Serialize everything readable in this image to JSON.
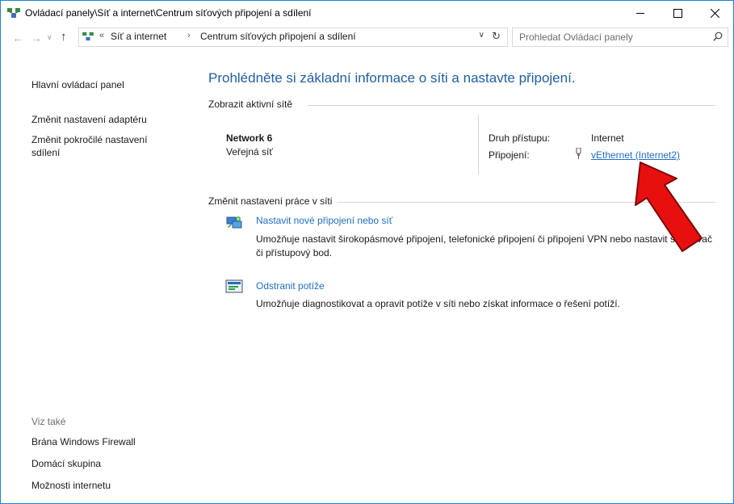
{
  "window": {
    "title": "Ovládací panely\\Síť a internet\\Centrum síťových připojení a sdílení",
    "controls": {
      "minimize": "—",
      "maximize": "☐",
      "close": "✕"
    }
  },
  "address": {
    "overflow": "«",
    "crumbs": [
      "Síť a internet",
      "Centrum síťových připojení a sdílení"
    ],
    "separator": "›",
    "search_placeholder": "Prohledat Ovládací panely"
  },
  "sidebar": {
    "main_link": "Hlavní ovládací panel",
    "links": [
      "Změnit nastavení adaptéru",
      "Změnit pokročilé nastavení sdílení"
    ],
    "see_also_title": "Viz také",
    "see_also": [
      "Brána Windows Firewall",
      "Domácí skupina",
      "Možnosti internetu"
    ]
  },
  "main": {
    "heading": "Prohlédněte si základní informace o síti a nastavte připojení.",
    "active_networks_label": "Zobrazit aktivní sítě",
    "network": {
      "name": "Network  6",
      "type": "Veřejná síť",
      "access_label": "Druh přístupu:",
      "access_value": "Internet",
      "connection_label": "Připojení:",
      "connection_value": "vEthernet (Internet2)"
    },
    "change_settings_label": "Změnit nastavení práce v síti",
    "tasks": [
      {
        "title": "Nastavit nové připojení nebo síť",
        "desc": "Umožňuje nastavit širokopásmové připojení, telefonické připojení či připojení VPN nebo nastavit směrovač či přístupový bod."
      },
      {
        "title": "Odstranit potíže",
        "desc": "Umožňuje diagnostikovat a opravit potíže v síti nebo získat informace o řešení potíží."
      }
    ]
  },
  "colors": {
    "heading": "#1e5fa8",
    "link": "#1e6fc7",
    "window_border": "#1883d7",
    "annotation_arrow": "#e8100e"
  },
  "icons": {
    "title": "network-center-icon",
    "back": "back-arrow-icon",
    "forward": "forward-arrow-icon",
    "up": "up-arrow-icon",
    "search": "search-icon",
    "refresh": "refresh-icon",
    "connection": "ethernet-plug-icon",
    "task1": "new-connection-icon",
    "task2": "troubleshoot-icon"
  }
}
